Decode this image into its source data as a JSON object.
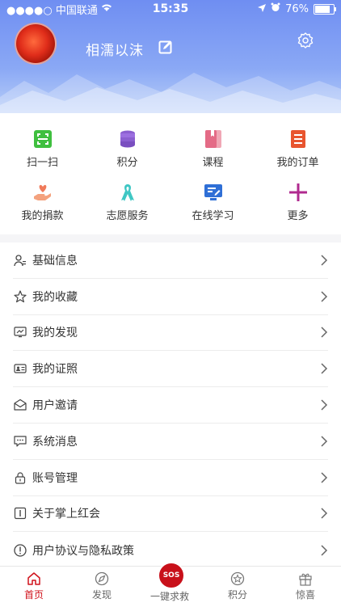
{
  "status_bar": {
    "carrier": "●●●●○ 中国联通",
    "time": "15:35",
    "battery": "76%"
  },
  "profile": {
    "username": "相濡以沫"
  },
  "quick_grid": [
    {
      "label": "扫一扫",
      "icon": "scan-icon"
    },
    {
      "label": "积分",
      "icon": "coins-icon"
    },
    {
      "label": "课程",
      "icon": "course-book-icon"
    },
    {
      "label": "我的订单",
      "icon": "order-list-icon"
    },
    {
      "label": "我的捐款",
      "icon": "donation-hand-heart-icon"
    },
    {
      "label": "志愿服务",
      "icon": "ribbon-icon"
    },
    {
      "label": "在线学习",
      "icon": "online-learning-icon"
    },
    {
      "label": "更多",
      "icon": "plus-icon"
    }
  ],
  "menu": [
    {
      "label": "基础信息",
      "icon": "user-info-icon"
    },
    {
      "label": "我的收藏",
      "icon": "star-icon"
    },
    {
      "label": "我的发现",
      "icon": "discover-screen-icon"
    },
    {
      "label": "我的证照",
      "icon": "id-card-icon"
    },
    {
      "label": "用户邀请",
      "icon": "invite-mail-icon"
    },
    {
      "label": "系统消息",
      "icon": "message-icon"
    },
    {
      "label": "账号管理",
      "icon": "lock-icon"
    },
    {
      "label": "关于掌上红会",
      "icon": "info-icon"
    },
    {
      "label": "用户协议与隐私政策",
      "icon": "exclamation-circle-icon"
    }
  ],
  "tabs": [
    {
      "label": "首页",
      "icon": "home-icon"
    },
    {
      "label": "发现",
      "icon": "discover-icon"
    },
    {
      "label": "一键求救",
      "icon": "sos-icon",
      "badge": "SOS"
    },
    {
      "label": "积分",
      "icon": "points-icon"
    },
    {
      "label": "惊喜",
      "icon": "gift-icon"
    }
  ],
  "colors": {
    "accent": "#d0121b",
    "header_top": "#6f8ef2",
    "header_bottom": "#b9cff8"
  }
}
